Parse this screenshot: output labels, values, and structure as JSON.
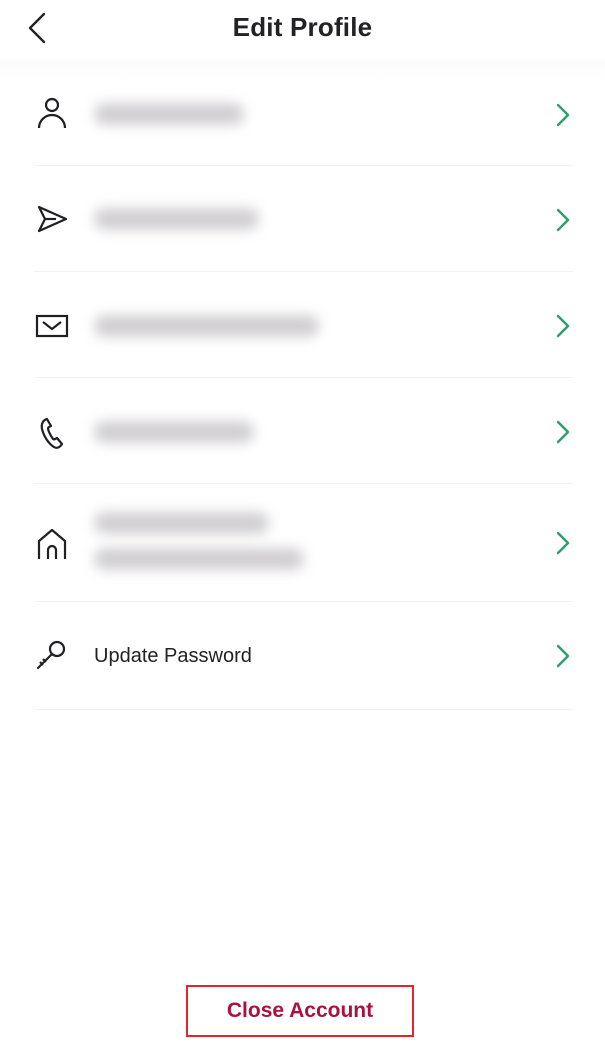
{
  "header": {
    "title": "Edit Profile",
    "back_icon": "chevron-left-icon"
  },
  "rows": [
    {
      "id": "name",
      "icon": "person-icon",
      "value": "[redacted name]",
      "redacted": true,
      "chevron_icon": "chevron-right-icon"
    },
    {
      "id": "display-name",
      "icon": "send-icon",
      "value": "[redacted name]",
      "redacted": true,
      "chevron_icon": "chevron-right-icon"
    },
    {
      "id": "email",
      "icon": "envelope-icon",
      "value": "[redacted email]",
      "redacted": true,
      "chevron_icon": "chevron-right-icon"
    },
    {
      "id": "phone",
      "icon": "phone-icon",
      "value": "[redacted phone]",
      "redacted": true,
      "chevron_icon": "chevron-right-icon"
    },
    {
      "id": "address",
      "icon": "home-icon",
      "value": "[redacted address]",
      "redacted": true,
      "chevron_icon": "chevron-right-icon"
    },
    {
      "id": "password",
      "icon": "key-icon",
      "value": "Update Password",
      "redacted": false,
      "chevron_icon": "chevron-right-icon"
    }
  ],
  "footer": {
    "close_account_label": "Close Account"
  },
  "colors": {
    "accent_green": "#2e9e6b",
    "danger_text": "#a8123e",
    "highlight_border": "#e3242b",
    "text": "#222226"
  }
}
